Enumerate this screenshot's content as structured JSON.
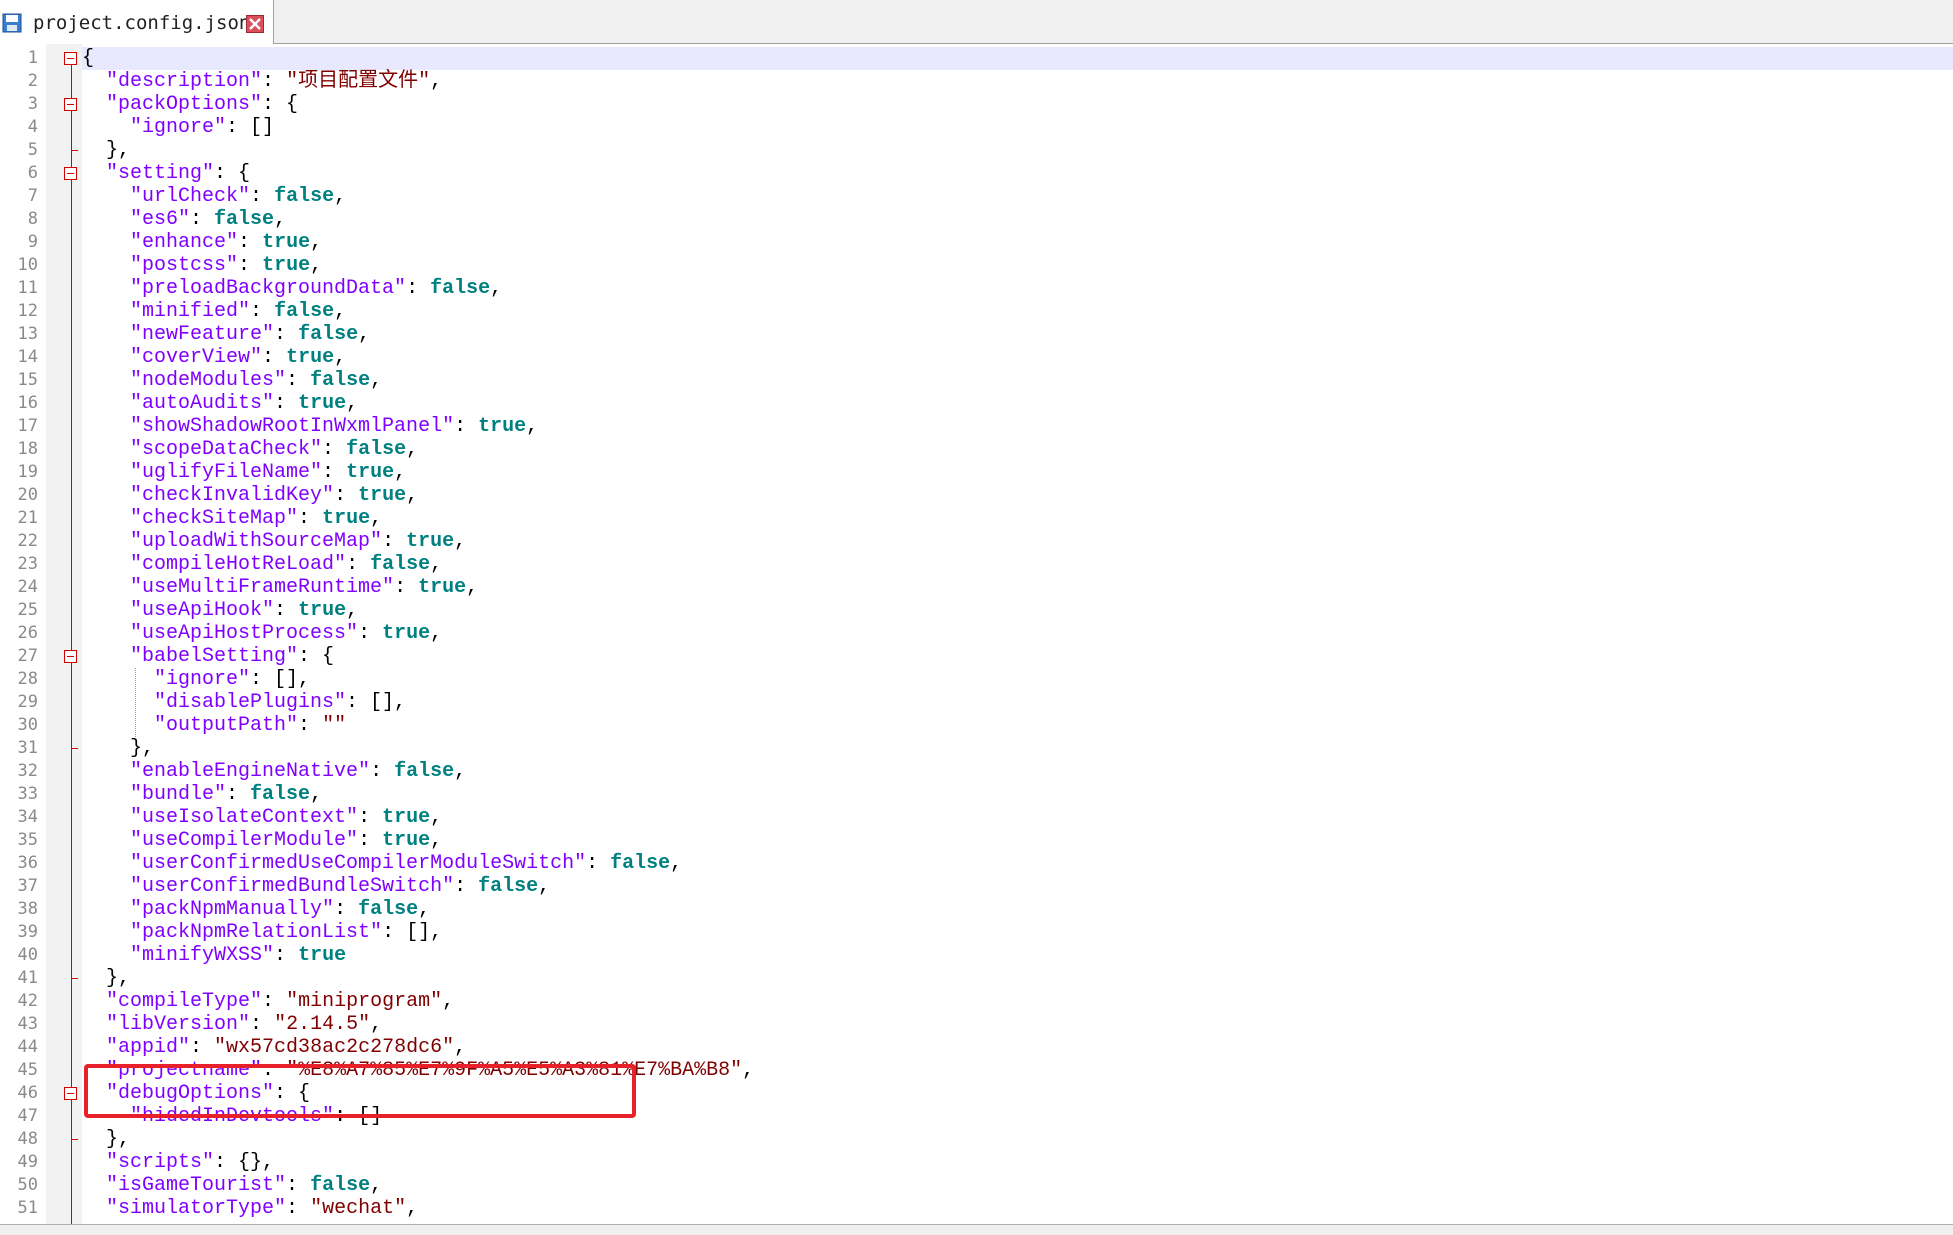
{
  "tab": {
    "filename": "project.config.json",
    "icon": "save-disk-icon",
    "close_icon": "close-icon",
    "accent": "#d40000"
  },
  "line_numbers": [
    "1",
    "2",
    "3",
    "4",
    "5",
    "6",
    "7",
    "8",
    "9",
    "10",
    "11",
    "12",
    "13",
    "14",
    "15",
    "16",
    "17",
    "18",
    "19",
    "20",
    "21",
    "22",
    "23",
    "24",
    "25",
    "26",
    "27",
    "28",
    "29",
    "30",
    "31",
    "32",
    "33",
    "34",
    "35",
    "36",
    "37",
    "38",
    "39",
    "40",
    "41",
    "42",
    "43",
    "44",
    "45",
    "46",
    "47",
    "48",
    "49",
    "50",
    "51"
  ],
  "lines": [
    {
      "ind": 0,
      "t": [
        [
          "p",
          "{"
        ]
      ]
    },
    {
      "ind": 1,
      "t": [
        [
          "k",
          "\"description\""
        ],
        [
          "p",
          ": "
        ],
        [
          "s",
          "\"项目配置文件\""
        ],
        [
          "p",
          ","
        ]
      ]
    },
    {
      "ind": 1,
      "t": [
        [
          "k",
          "\"packOptions\""
        ],
        [
          "p",
          ": {"
        ]
      ]
    },
    {
      "ind": 2,
      "t": [
        [
          "k",
          "\"ignore\""
        ],
        [
          "p",
          ": []"
        ]
      ]
    },
    {
      "ind": 1,
      "t": [
        [
          "p",
          "},"
        ]
      ]
    },
    {
      "ind": 1,
      "t": [
        [
          "k",
          "\"setting\""
        ],
        [
          "p",
          ": {"
        ]
      ]
    },
    {
      "ind": 2,
      "t": [
        [
          "k",
          "\"urlCheck\""
        ],
        [
          "p",
          ": "
        ],
        [
          "b",
          "false"
        ],
        [
          "p",
          ","
        ]
      ]
    },
    {
      "ind": 2,
      "t": [
        [
          "k",
          "\"es6\""
        ],
        [
          "p",
          ": "
        ],
        [
          "b",
          "false"
        ],
        [
          "p",
          ","
        ]
      ]
    },
    {
      "ind": 2,
      "t": [
        [
          "k",
          "\"enhance\""
        ],
        [
          "p",
          ": "
        ],
        [
          "b",
          "true"
        ],
        [
          "p",
          ","
        ]
      ]
    },
    {
      "ind": 2,
      "t": [
        [
          "k",
          "\"postcss\""
        ],
        [
          "p",
          ": "
        ],
        [
          "b",
          "true"
        ],
        [
          "p",
          ","
        ]
      ]
    },
    {
      "ind": 2,
      "t": [
        [
          "k",
          "\"preloadBackgroundData\""
        ],
        [
          "p",
          ": "
        ],
        [
          "b",
          "false"
        ],
        [
          "p",
          ","
        ]
      ]
    },
    {
      "ind": 2,
      "t": [
        [
          "k",
          "\"minified\""
        ],
        [
          "p",
          ": "
        ],
        [
          "b",
          "false"
        ],
        [
          "p",
          ","
        ]
      ]
    },
    {
      "ind": 2,
      "t": [
        [
          "k",
          "\"newFeature\""
        ],
        [
          "p",
          ": "
        ],
        [
          "b",
          "false"
        ],
        [
          "p",
          ","
        ]
      ]
    },
    {
      "ind": 2,
      "t": [
        [
          "k",
          "\"coverView\""
        ],
        [
          "p",
          ": "
        ],
        [
          "b",
          "true"
        ],
        [
          "p",
          ","
        ]
      ]
    },
    {
      "ind": 2,
      "t": [
        [
          "k",
          "\"nodeModules\""
        ],
        [
          "p",
          ": "
        ],
        [
          "b",
          "false"
        ],
        [
          "p",
          ","
        ]
      ]
    },
    {
      "ind": 2,
      "t": [
        [
          "k",
          "\"autoAudits\""
        ],
        [
          "p",
          ": "
        ],
        [
          "b",
          "true"
        ],
        [
          "p",
          ","
        ]
      ]
    },
    {
      "ind": 2,
      "t": [
        [
          "k",
          "\"showShadowRootInWxmlPanel\""
        ],
        [
          "p",
          ": "
        ],
        [
          "b",
          "true"
        ],
        [
          "p",
          ","
        ]
      ]
    },
    {
      "ind": 2,
      "t": [
        [
          "k",
          "\"scopeDataCheck\""
        ],
        [
          "p",
          ": "
        ],
        [
          "b",
          "false"
        ],
        [
          "p",
          ","
        ]
      ]
    },
    {
      "ind": 2,
      "t": [
        [
          "k",
          "\"uglifyFileName\""
        ],
        [
          "p",
          ": "
        ],
        [
          "b",
          "true"
        ],
        [
          "p",
          ","
        ]
      ]
    },
    {
      "ind": 2,
      "t": [
        [
          "k",
          "\"checkInvalidKey\""
        ],
        [
          "p",
          ": "
        ],
        [
          "b",
          "true"
        ],
        [
          "p",
          ","
        ]
      ]
    },
    {
      "ind": 2,
      "t": [
        [
          "k",
          "\"checkSiteMap\""
        ],
        [
          "p",
          ": "
        ],
        [
          "b",
          "true"
        ],
        [
          "p",
          ","
        ]
      ]
    },
    {
      "ind": 2,
      "t": [
        [
          "k",
          "\"uploadWithSourceMap\""
        ],
        [
          "p",
          ": "
        ],
        [
          "b",
          "true"
        ],
        [
          "p",
          ","
        ]
      ]
    },
    {
      "ind": 2,
      "t": [
        [
          "k",
          "\"compileHotReLoad\""
        ],
        [
          "p",
          ": "
        ],
        [
          "b",
          "false"
        ],
        [
          "p",
          ","
        ]
      ]
    },
    {
      "ind": 2,
      "t": [
        [
          "k",
          "\"useMultiFrameRuntime\""
        ],
        [
          "p",
          ": "
        ],
        [
          "b",
          "true"
        ],
        [
          "p",
          ","
        ]
      ]
    },
    {
      "ind": 2,
      "t": [
        [
          "k",
          "\"useApiHook\""
        ],
        [
          "p",
          ": "
        ],
        [
          "b",
          "true"
        ],
        [
          "p",
          ","
        ]
      ]
    },
    {
      "ind": 2,
      "t": [
        [
          "k",
          "\"useApiHostProcess\""
        ],
        [
          "p",
          ": "
        ],
        [
          "b",
          "true"
        ],
        [
          "p",
          ","
        ]
      ]
    },
    {
      "ind": 2,
      "t": [
        [
          "k",
          "\"babelSetting\""
        ],
        [
          "p",
          ": {"
        ]
      ]
    },
    {
      "ind": 3,
      "t": [
        [
          "k",
          "\"ignore\""
        ],
        [
          "p",
          ": [],"
        ]
      ]
    },
    {
      "ind": 3,
      "t": [
        [
          "k",
          "\"disablePlugins\""
        ],
        [
          "p",
          ": [],"
        ]
      ]
    },
    {
      "ind": 3,
      "t": [
        [
          "k",
          "\"outputPath\""
        ],
        [
          "p",
          ": "
        ],
        [
          "s",
          "\"\""
        ]
      ]
    },
    {
      "ind": 2,
      "t": [
        [
          "p",
          "},"
        ]
      ]
    },
    {
      "ind": 2,
      "t": [
        [
          "k",
          "\"enableEngineNative\""
        ],
        [
          "p",
          ": "
        ],
        [
          "b",
          "false"
        ],
        [
          "p",
          ","
        ]
      ]
    },
    {
      "ind": 2,
      "t": [
        [
          "k",
          "\"bundle\""
        ],
        [
          "p",
          ": "
        ],
        [
          "b",
          "false"
        ],
        [
          "p",
          ","
        ]
      ]
    },
    {
      "ind": 2,
      "t": [
        [
          "k",
          "\"useIsolateContext\""
        ],
        [
          "p",
          ": "
        ],
        [
          "b",
          "true"
        ],
        [
          "p",
          ","
        ]
      ]
    },
    {
      "ind": 2,
      "t": [
        [
          "k",
          "\"useCompilerModule\""
        ],
        [
          "p",
          ": "
        ],
        [
          "b",
          "true"
        ],
        [
          "p",
          ","
        ]
      ]
    },
    {
      "ind": 2,
      "t": [
        [
          "k",
          "\"userConfirmedUseCompilerModuleSwitch\""
        ],
        [
          "p",
          ": "
        ],
        [
          "b",
          "false"
        ],
        [
          "p",
          ","
        ]
      ]
    },
    {
      "ind": 2,
      "t": [
        [
          "k",
          "\"userConfirmedBundleSwitch\""
        ],
        [
          "p",
          ": "
        ],
        [
          "b",
          "false"
        ],
        [
          "p",
          ","
        ]
      ]
    },
    {
      "ind": 2,
      "t": [
        [
          "k",
          "\"packNpmManually\""
        ],
        [
          "p",
          ": "
        ],
        [
          "b",
          "false"
        ],
        [
          "p",
          ","
        ]
      ]
    },
    {
      "ind": 2,
      "t": [
        [
          "k",
          "\"packNpmRelationList\""
        ],
        [
          "p",
          ": [],"
        ]
      ]
    },
    {
      "ind": 2,
      "t": [
        [
          "k",
          "\"minifyWXSS\""
        ],
        [
          "p",
          ": "
        ],
        [
          "b",
          "true"
        ]
      ]
    },
    {
      "ind": 1,
      "t": [
        [
          "p",
          "},"
        ]
      ]
    },
    {
      "ind": 1,
      "t": [
        [
          "k",
          "\"compileType\""
        ],
        [
          "p",
          ": "
        ],
        [
          "s",
          "\"miniprogram\""
        ],
        [
          "p",
          ","
        ]
      ]
    },
    {
      "ind": 1,
      "t": [
        [
          "k",
          "\"libVersion\""
        ],
        [
          "p",
          ": "
        ],
        [
          "s",
          "\"2.14.5\""
        ],
        [
          "p",
          ","
        ]
      ]
    },
    {
      "ind": 1,
      "t": [
        [
          "k",
          "\"appid\""
        ],
        [
          "p",
          ": "
        ],
        [
          "s",
          "\"wx57cd38ac2c278dc6\""
        ],
        [
          "p",
          ","
        ]
      ]
    },
    {
      "ind": 1,
      "t": [
        [
          "k",
          "\"projectname\""
        ],
        [
          "p",
          ": "
        ],
        [
          "s",
          "\"%E8%A7%85%E7%9F%A5%E5%A3%81%E7%BA%B8\""
        ],
        [
          "p",
          ","
        ]
      ]
    },
    {
      "ind": 1,
      "t": [
        [
          "k",
          "\"debugOptions\""
        ],
        [
          "p",
          ": {"
        ]
      ]
    },
    {
      "ind": 2,
      "t": [
        [
          "k",
          "\"hidedInDevtools\""
        ],
        [
          "p",
          ": []"
        ]
      ]
    },
    {
      "ind": 1,
      "t": [
        [
          "p",
          "},"
        ]
      ]
    },
    {
      "ind": 1,
      "t": [
        [
          "k",
          "\"scripts\""
        ],
        [
          "p",
          ": {},"
        ]
      ]
    },
    {
      "ind": 1,
      "t": [
        [
          "k",
          "\"isGameTourist\""
        ],
        [
          "p",
          ": "
        ],
        [
          "b",
          "false"
        ],
        [
          "p",
          ","
        ]
      ]
    },
    {
      "ind": 1,
      "t": [
        [
          "k",
          "\"simulatorType\""
        ],
        [
          "p",
          ": "
        ],
        [
          "s",
          "\"wechat\""
        ],
        [
          "p",
          ","
        ]
      ]
    }
  ],
  "fold_open_lines": [
    1,
    3,
    6,
    27,
    46
  ],
  "fold_end_lines": [
    5,
    31,
    41,
    48
  ],
  "highlight": {
    "first_line": 43,
    "last_line": 45,
    "color": "#e8202a"
  },
  "colors": {
    "key": "#8000ff",
    "string": "#800000",
    "boolean": "#008080",
    "punct": "#000000"
  }
}
